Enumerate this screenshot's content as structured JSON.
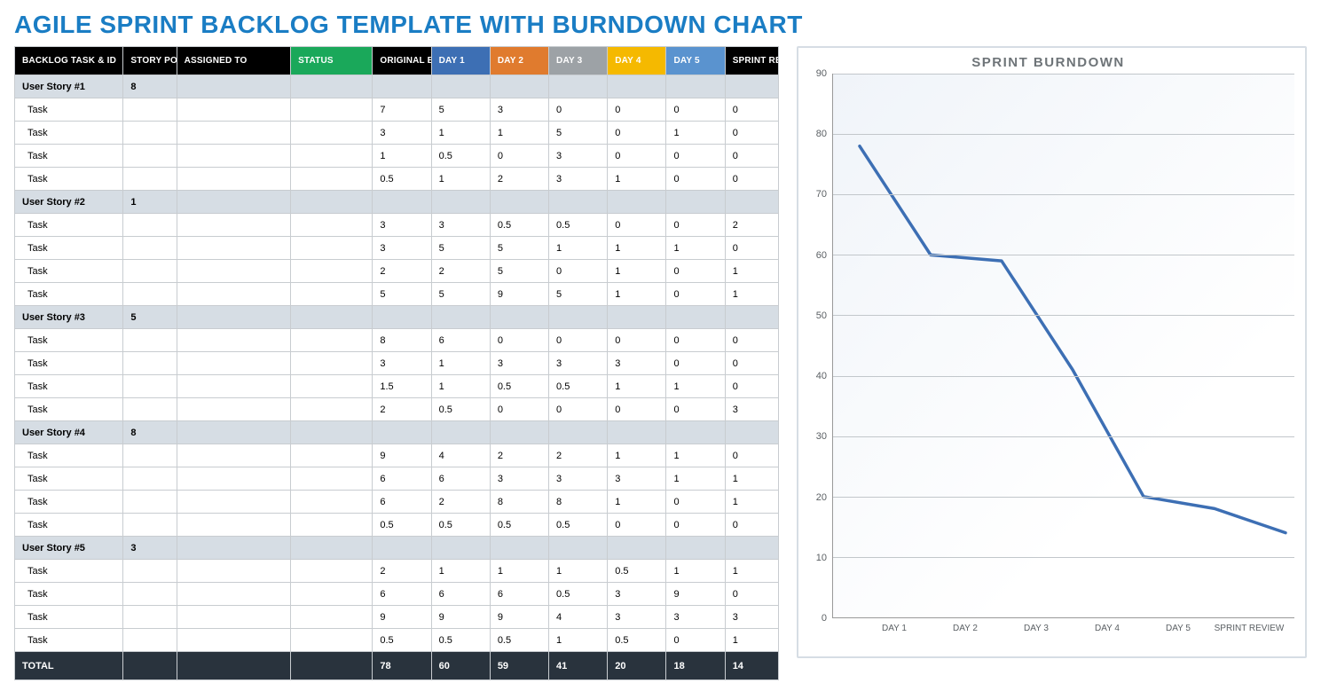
{
  "title": "AGILE SPRINT BACKLOG TEMPLATE WITH BURNDOWN CHART",
  "columns": {
    "task": "BACKLOG TASK & ID",
    "sp": "STORY POINTS",
    "assigned": "ASSIGNED TO",
    "status": "STATUS",
    "estimate": "ORIGINAL ESTIMATE",
    "day1": "DAY 1",
    "day2": "DAY 2",
    "day3": "DAY 3",
    "day4": "DAY 4",
    "day5": "DAY 5",
    "review": "SPRINT REVIEW"
  },
  "groups": [
    {
      "story": "User Story #1",
      "points": "8",
      "tasks": [
        {
          "name": "Task",
          "est": "7",
          "d1": "5",
          "d2": "3",
          "d3": "0",
          "d4": "0",
          "d5": "0",
          "rev": "0"
        },
        {
          "name": "Task",
          "est": "3",
          "d1": "1",
          "d2": "1",
          "d3": "5",
          "d4": "0",
          "d5": "1",
          "rev": "0"
        },
        {
          "name": "Task",
          "est": "1",
          "d1": "0.5",
          "d2": "0",
          "d3": "3",
          "d4": "0",
          "d5": "0",
          "rev": "0"
        },
        {
          "name": "Task",
          "est": "0.5",
          "d1": "1",
          "d2": "2",
          "d3": "3",
          "d4": "1",
          "d5": "0",
          "rev": "0"
        }
      ]
    },
    {
      "story": "User Story #2",
      "points": "1",
      "tasks": [
        {
          "name": "Task",
          "est": "3",
          "d1": "3",
          "d2": "0.5",
          "d3": "0.5",
          "d4": "0",
          "d5": "0",
          "rev": "2"
        },
        {
          "name": "Task",
          "est": "3",
          "d1": "5",
          "d2": "5",
          "d3": "1",
          "d4": "1",
          "d5": "1",
          "rev": "0"
        },
        {
          "name": "Task",
          "est": "2",
          "d1": "2",
          "d2": "5",
          "d3": "0",
          "d4": "1",
          "d5": "0",
          "rev": "1"
        },
        {
          "name": "Task",
          "est": "5",
          "d1": "5",
          "d2": "9",
          "d3": "5",
          "d4": "1",
          "d5": "0",
          "rev": "1"
        }
      ]
    },
    {
      "story": "User Story #3",
      "points": "5",
      "tasks": [
        {
          "name": "Task",
          "est": "8",
          "d1": "6",
          "d2": "0",
          "d3": "0",
          "d4": "0",
          "d5": "0",
          "rev": "0"
        },
        {
          "name": "Task",
          "est": "3",
          "d1": "1",
          "d2": "3",
          "d3": "3",
          "d4": "3",
          "d5": "0",
          "rev": "0"
        },
        {
          "name": "Task",
          "est": "1.5",
          "d1": "1",
          "d2": "0.5",
          "d3": "0.5",
          "d4": "1",
          "d5": "1",
          "rev": "0"
        },
        {
          "name": "Task",
          "est": "2",
          "d1": "0.5",
          "d2": "0",
          "d3": "0",
          "d4": "0",
          "d5": "0",
          "rev": "3"
        }
      ]
    },
    {
      "story": "User Story #4",
      "points": "8",
      "tasks": [
        {
          "name": "Task",
          "est": "9",
          "d1": "4",
          "d2": "2",
          "d3": "2",
          "d4": "1",
          "d5": "1",
          "rev": "0"
        },
        {
          "name": "Task",
          "est": "6",
          "d1": "6",
          "d2": "3",
          "d3": "3",
          "d4": "3",
          "d5": "1",
          "rev": "1"
        },
        {
          "name": "Task",
          "est": "6",
          "d1": "2",
          "d2": "8",
          "d3": "8",
          "d4": "1",
          "d5": "0",
          "rev": "1"
        },
        {
          "name": "Task",
          "est": "0.5",
          "d1": "0.5",
          "d2": "0.5",
          "d3": "0.5",
          "d4": "0",
          "d5": "0",
          "rev": "0"
        }
      ]
    },
    {
      "story": "User Story #5",
      "points": "3",
      "tasks": [
        {
          "name": "Task",
          "est": "2",
          "d1": "1",
          "d2": "1",
          "d3": "1",
          "d4": "0.5",
          "d5": "1",
          "rev": "1"
        },
        {
          "name": "Task",
          "est": "6",
          "d1": "6",
          "d2": "6",
          "d3": "0.5",
          "d4": "3",
          "d5": "9",
          "rev": "0"
        },
        {
          "name": "Task",
          "est": "9",
          "d1": "9",
          "d2": "9",
          "d3": "4",
          "d4": "3",
          "d5": "3",
          "rev": "3"
        },
        {
          "name": "Task",
          "est": "0.5",
          "d1": "0.5",
          "d2": "0.5",
          "d3": "1",
          "d4": "0.5",
          "d5": "0",
          "rev": "1"
        }
      ]
    }
  ],
  "total": {
    "label": "TOTAL",
    "est": "78",
    "d1": "60",
    "d2": "59",
    "d3": "41",
    "d4": "20",
    "d5": "18",
    "rev": "14"
  },
  "chart_data": {
    "type": "line",
    "title": "SPRINT BURNDOWN",
    "categories": [
      "DAY 1",
      "DAY 2",
      "DAY 3",
      "DAY 4",
      "DAY 5",
      "SPRINT REVIEW"
    ],
    "values": [
      78,
      60,
      59,
      41,
      20,
      18,
      14
    ],
    "ylabel": "",
    "xlabel": "",
    "ylim": [
      0,
      90
    ],
    "yticks": [
      0,
      10,
      20,
      30,
      40,
      50,
      60,
      70,
      80,
      90
    ],
    "line_color": "#3d6fb4"
  }
}
